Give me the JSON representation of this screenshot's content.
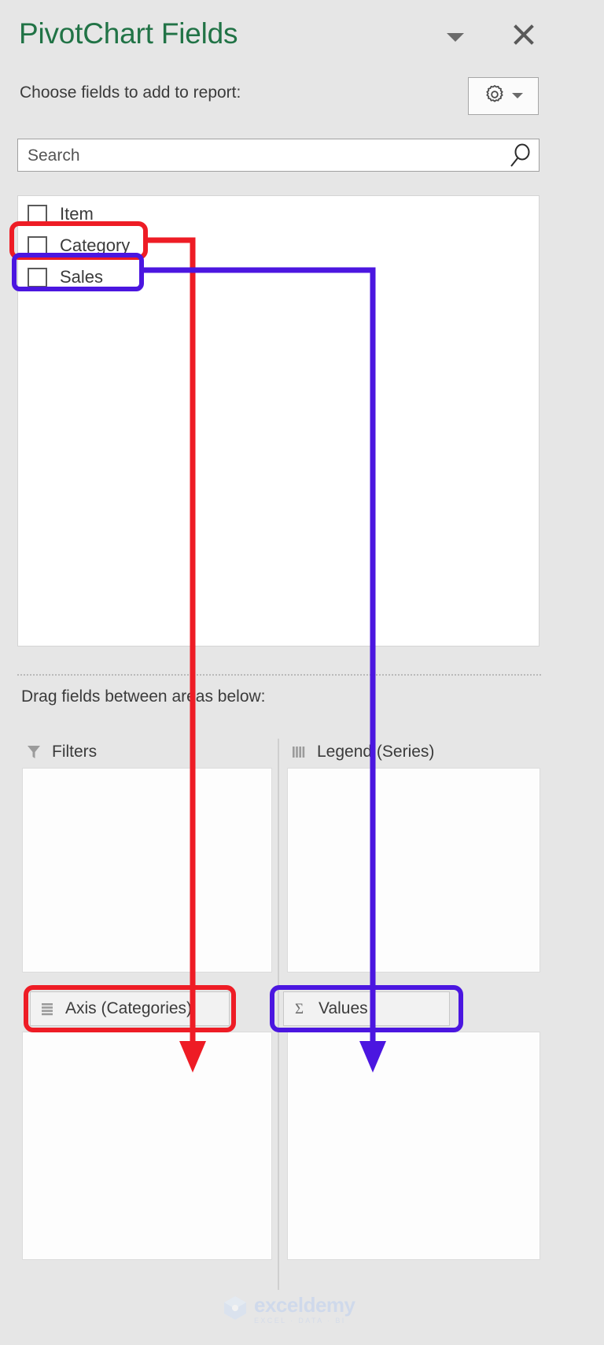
{
  "pane": {
    "title": "PivotChart Fields",
    "title_color": "#217346",
    "choose_label": "Choose fields to add to report:",
    "collapse_icon": "chevron-down-icon",
    "close_icon": "close-icon",
    "tools_icon": "gear-icon",
    "tools_dropdown_icon": "chevron-down-icon"
  },
  "search": {
    "placeholder": "Search",
    "value": "",
    "icon": "search-icon"
  },
  "fields": [
    {
      "label": "Item",
      "checked": false
    },
    {
      "label": "Category",
      "checked": false
    },
    {
      "label": "Sales",
      "checked": false
    }
  ],
  "areas": {
    "drag_label": "Drag fields between areas below:",
    "filters": {
      "label": "Filters",
      "icon": "filter-funnel-icon",
      "items": []
    },
    "legend": {
      "label": "Legend (Series)",
      "icon": "columns-icon",
      "items": []
    },
    "axis": {
      "label": "Axis (Categories)",
      "icon": "rows-icon",
      "items": []
    },
    "values": {
      "label": "Values",
      "icon": "sigma-icon",
      "items": []
    }
  },
  "annotations": {
    "red_color": "#ee1c25",
    "blue_color": "#4b16e0",
    "red_from": "Category",
    "red_to": "Axis (Categories)",
    "blue_from": "Sales",
    "blue_to": "Values"
  },
  "watermark": {
    "name": "exceldemy",
    "tagline": "EXCEL · DATA · BI"
  }
}
